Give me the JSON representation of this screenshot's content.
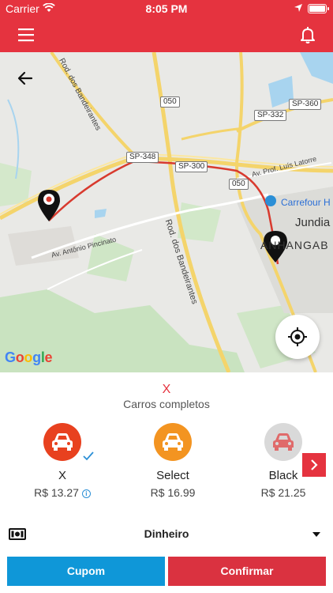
{
  "status_bar": {
    "carrier": "Carrier",
    "time": "8:05 PM"
  },
  "nav": {
    "menu_icon": "hamburger-menu-icon",
    "bell_icon": "bell-icon",
    "color": "#e5333f"
  },
  "map": {
    "labels": {
      "bandeirantes_top": "Rod. dos Bandeirantes",
      "sp348": "SP-348",
      "sp300": "SP-300",
      "sp332": "SP-332",
      "sp360": "SP-360",
      "r050a": "050",
      "r050b": "050",
      "rod_band": "Rod. dos Bandeirantes",
      "av_prof": "Av. Prof. Luís Latorre",
      "av_antonio": "Av. Antônio Pincinato",
      "carrefour": "Carrefour H",
      "jundiai": "Jundia",
      "anhangaba": "ANHANGAB"
    },
    "google": [
      "G",
      "o",
      "o",
      "g",
      "l",
      "e"
    ],
    "route_color": "#d83a2e"
  },
  "ride": {
    "category": "X",
    "category_subtitle": "Carros completos",
    "options": [
      {
        "name": "X",
        "price": "R$ 13.27",
        "color": "#e8411f",
        "selected": true
      },
      {
        "name": "Select",
        "price": "R$ 16.99",
        "color": "#f39421",
        "selected": false
      },
      {
        "name": "Black",
        "price": "R$ 21.25",
        "color": "#d9d9d9",
        "selected": false
      }
    ]
  },
  "payment": {
    "method": "Dinheiro"
  },
  "actions": {
    "coupon": "Cupom",
    "confirm": "Confirmar"
  },
  "colors": {
    "accent": "#e5333f",
    "coupon": "#0f97d8",
    "confirm": "#da3240"
  }
}
